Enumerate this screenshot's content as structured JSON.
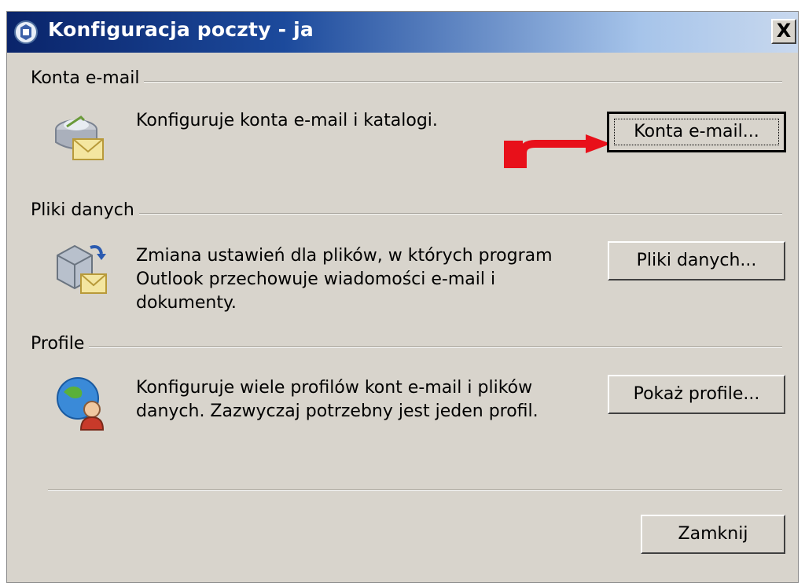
{
  "window": {
    "title": "Konfiguracja poczty - ja",
    "close_glyph": "X"
  },
  "sections": [
    {
      "label": "Konta e-mail",
      "icon": "mail-accounts-icon",
      "description": [
        "Konfiguruje konta e-mail i katalogi."
      ],
      "button_label": "Konta e-mail..."
    },
    {
      "label": "Pliki danych",
      "icon": "data-files-icon",
      "description": [
        "Zmiana ustawień dla plików, w których program",
        "Outlook przechowuje wiadomości e-mail i",
        "dokumenty."
      ],
      "button_label": "Pliki danych..."
    },
    {
      "label": "Profile",
      "icon": "profiles-icon",
      "description": [
        "Konfiguruje wiele profilów kont e-mail i plików",
        "danych. Zazwyczaj potrzebny jest jeden profil."
      ],
      "button_label": "Pokaż profile..."
    }
  ],
  "footer": {
    "close_button_label": "Zamknij"
  },
  "colors": {
    "dialog_bg": "#d8d4cc",
    "title_gradient_start": "#0a246a",
    "arrow": "#e8101a"
  }
}
